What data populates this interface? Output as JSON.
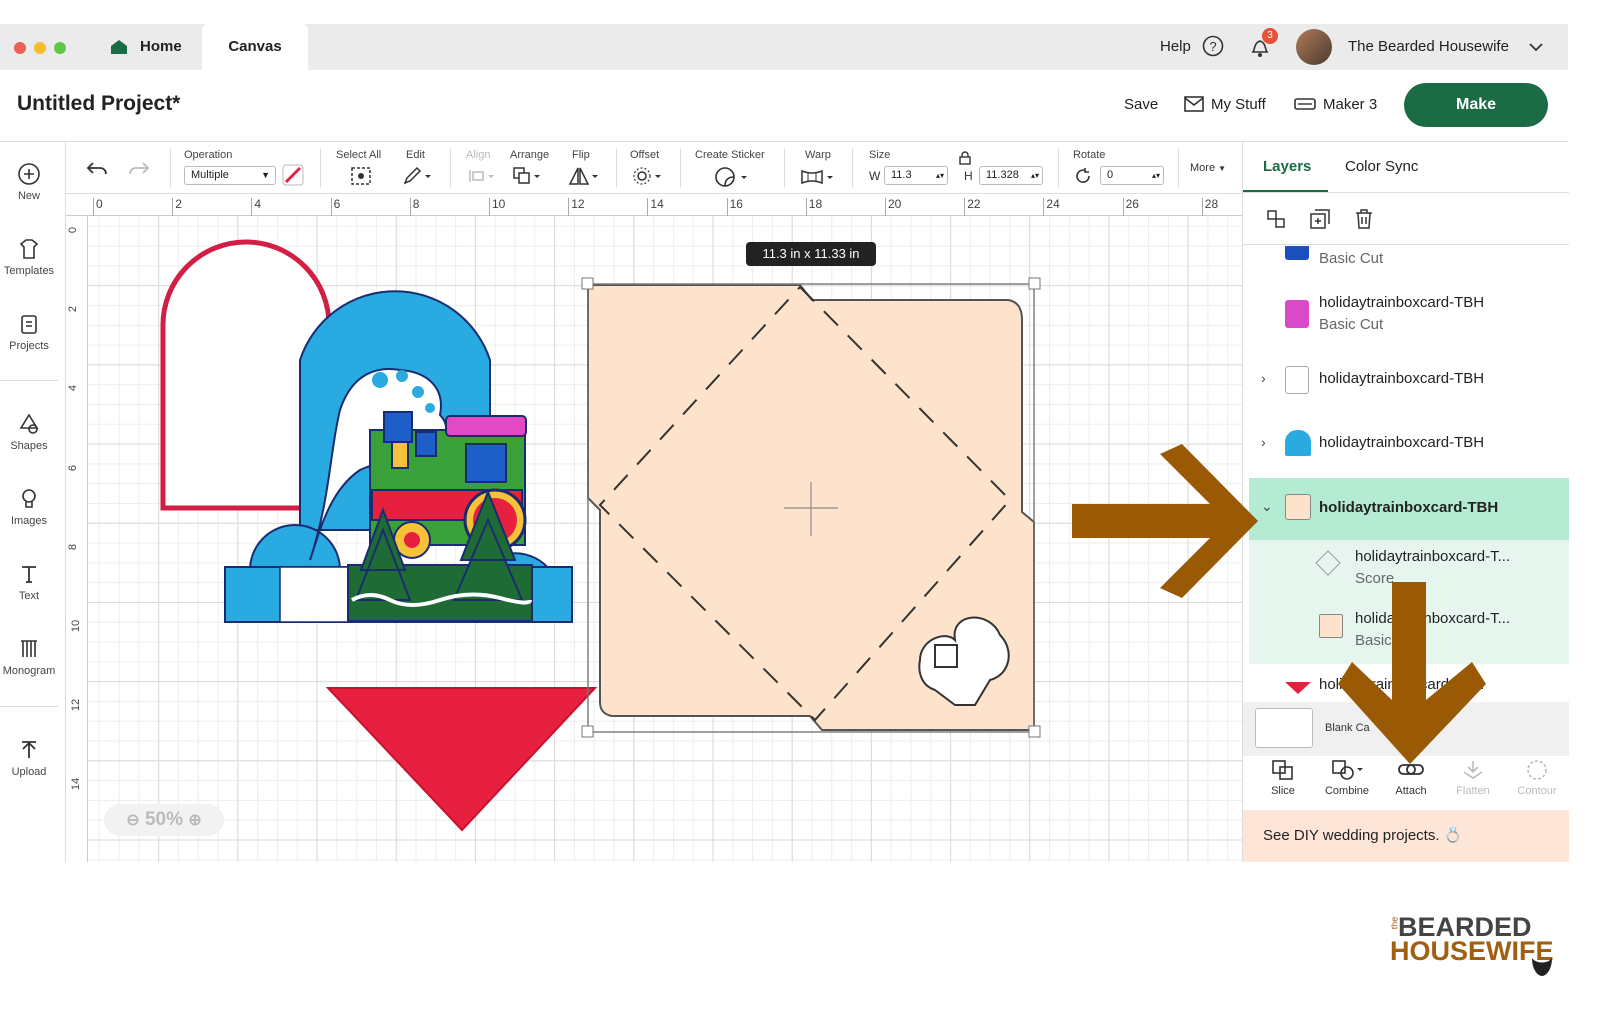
{
  "tabs": {
    "home": "Home",
    "canvas": "Canvas"
  },
  "top_right": {
    "help": "Help",
    "notification_count": "3",
    "user_name": "The Bearded Housewife"
  },
  "header": {
    "project_title": "Untitled Project*",
    "save": "Save",
    "my_stuff": "My Stuff",
    "machine": "Maker 3",
    "make": "Make"
  },
  "left_sidebar": [
    "New",
    "Templates",
    "Projects",
    "Shapes",
    "Images",
    "Text",
    "Monogram",
    "Upload"
  ],
  "toolbar": {
    "operation_label": "Operation",
    "operation_value": "Multiple",
    "select_all": "Select All",
    "edit": "Edit",
    "align": "Align",
    "arrange": "Arrange",
    "flip": "Flip",
    "offset": "Offset",
    "create_sticker": "Create Sticker",
    "warp": "Warp",
    "size": "Size",
    "w_label": "W",
    "w_value": "11.3",
    "h_label": "H",
    "h_value": "11.328",
    "rotate": "Rotate",
    "rotate_value": "0",
    "more": "More"
  },
  "ruler_top": [
    "0",
    "2",
    "4",
    "6",
    "8",
    "10",
    "12",
    "14",
    "16",
    "18",
    "20",
    "22",
    "24",
    "26",
    "28"
  ],
  "ruler_left": [
    "0",
    "2",
    "4",
    "6",
    "8",
    "10",
    "12",
    "14"
  ],
  "canvas": {
    "size_tooltip": "11.3  in x 11.33  in",
    "zoom": "50%"
  },
  "colors": {
    "make_green": "#1b6b45",
    "arrow_brown": "#9a5a05",
    "selected_layer": "#b5ead3",
    "group_bg": "#e6f6ef",
    "card_peach": "#fde3cb",
    "red": "#e8203f"
  },
  "right_panel": {
    "tab_layers": "Layers",
    "tab_color_sync": "Color Sync",
    "layers": [
      {
        "name": "",
        "sub": "Basic Cut"
      },
      {
        "name": "holidaytrainboxcard-TBH",
        "sub": "Basic Cut"
      },
      {
        "name": "holidaytrainboxcard-TBH",
        "sub": ""
      },
      {
        "name": "holidaytrainboxcard-TBH",
        "sub": ""
      },
      {
        "name": "holidaytrainboxcard-TBH",
        "sub": ""
      },
      {
        "name": "holidaytrainboxcard-T...",
        "sub": "Score"
      },
      {
        "name": "holidaytrainboxcard-T...",
        "sub": "Basic"
      },
      {
        "name": "holidaytrainboxcard-TBH",
        "sub": ""
      }
    ],
    "blank_canvas": "Blank Ca",
    "actions": [
      "Slice",
      "Combine",
      "Attach",
      "Flatten",
      "Contour"
    ],
    "promo": "See DIY wedding projects."
  },
  "watermark": {
    "line1": "BEARDED",
    "line2": "HOUSEWIFE",
    "small": "the"
  }
}
